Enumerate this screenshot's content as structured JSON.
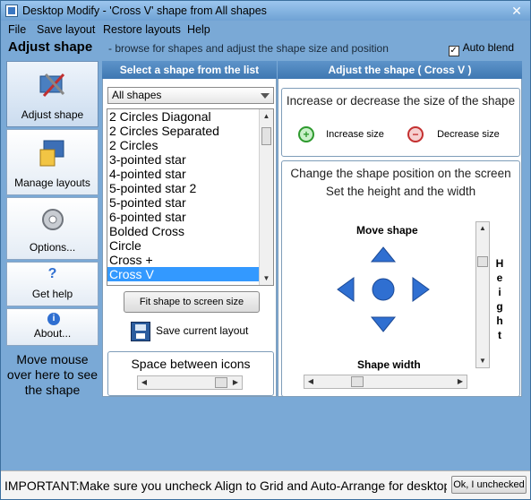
{
  "window": {
    "title": "Desktop Modify - 'Cross V' shape from All shapes"
  },
  "menu": [
    "File",
    "Save layout",
    "Restore layouts",
    "Help"
  ],
  "header": {
    "title": "Adjust shape",
    "description": "- browse for shapes and adjust the shape size and position",
    "auto_blend_label": "Auto blend",
    "auto_blend_checked": true
  },
  "sidebar": {
    "items": [
      {
        "label": "Adjust shape",
        "icon": "adjust-shape-icon",
        "active": true
      },
      {
        "label": "Manage layouts",
        "icon": "manage-layouts-icon",
        "active": false
      },
      {
        "label": "Options...",
        "icon": "gear-icon",
        "active": false
      },
      {
        "label": "Get help",
        "icon": "help-icon",
        "active": false
      },
      {
        "label": "About...",
        "icon": "info-icon",
        "active": false
      }
    ],
    "hover_tip": "Move mouse over here to see the shape"
  },
  "select_panel": {
    "header": "Select a shape from the list",
    "dropdown_value": "All shapes",
    "shapes": [
      "2 Circles Diagonal",
      "2 Circles Separated",
      "2 Circles",
      "3-pointed star",
      "4-pointed star",
      "5-pointed star 2",
      "5-pointed star",
      "6-pointed star",
      "Bolded Cross",
      "Circle",
      "Cross +",
      "Cross V"
    ],
    "selected_shape": "Cross V",
    "fit_button": "Fit shape to screen size",
    "save_layout_label": "Save current layout",
    "spacing_label": "Space between icons"
  },
  "adjust_panel": {
    "header": "Adjust the shape ( Cross V )",
    "size_title": "Increase or decrease the size of the shape",
    "increase_label": "Increase size",
    "decrease_label": "Decrease size",
    "position_text": "Change the shape position on the screen  Set the height and the width",
    "move_label": "Move shape",
    "width_label": "Shape width",
    "height_label": "Height"
  },
  "footer": {
    "important_text": "IMPORTANT:Make sure you uncheck Align to Grid and Auto-Arrange for desktop",
    "ok_button": "Ok, I unchecked"
  },
  "colors": {
    "panel_header": "#4a85bf",
    "window_chrome": "#7aa9d6",
    "selection": "#3399ff",
    "arrow_blue": "#2f6fd1"
  }
}
